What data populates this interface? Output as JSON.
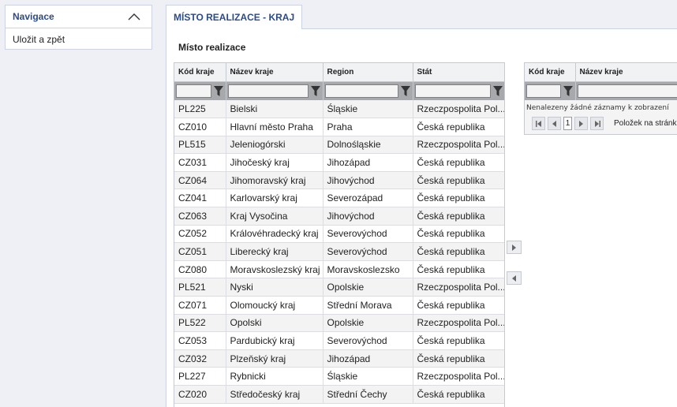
{
  "nav": {
    "title": "Navigace",
    "items": [
      {
        "label": "Uložit a zpět"
      }
    ]
  },
  "tab": {
    "label": "MÍSTO REALIZACE - KRAJ"
  },
  "section": {
    "title": "Místo realizace"
  },
  "left_grid": {
    "columns": [
      "Kód kraje",
      "Název kraje",
      "Region",
      "Stát"
    ],
    "rows": [
      [
        "PL225",
        "Bielski",
        "Śląskie",
        "Rzeczpospolita Pol..."
      ],
      [
        "CZ010",
        "Hlavní město Praha",
        "Praha",
        "Česká republika"
      ],
      [
        "PL515",
        "Jeleniogórski",
        "Dolnośląskie",
        "Rzeczpospolita Pol..."
      ],
      [
        "CZ031",
        "Jihočeský kraj",
        "Jihozápad",
        "Česká republika"
      ],
      [
        "CZ064",
        "Jihomoravský kraj",
        "Jihovýchod",
        "Česká republika"
      ],
      [
        "CZ041",
        "Karlovarský kraj",
        "Severozápad",
        "Česká republika"
      ],
      [
        "CZ063",
        "Kraj Vysočina",
        "Jihovýchod",
        "Česká republika"
      ],
      [
        "CZ052",
        "Královéhradecký kraj",
        "Severovýchod",
        "Česká republika"
      ],
      [
        "CZ051",
        "Liberecký kraj",
        "Severovýchod",
        "Česká republika"
      ],
      [
        "CZ080",
        "Moravskoslezský kraj",
        "Moravskoslezsko",
        "Česká republika"
      ],
      [
        "PL521",
        "Nyski",
        "Opolskie",
        "Rzeczpospolita Pol..."
      ],
      [
        "CZ071",
        "Olomoucký kraj",
        "Střední Morava",
        "Česká republika"
      ],
      [
        "PL522",
        "Opolski",
        "Opolskie",
        "Rzeczpospolita Pol..."
      ],
      [
        "CZ053",
        "Pardubický kraj",
        "Severovýchod",
        "Česká republika"
      ],
      [
        "CZ032",
        "Plzeňský kraj",
        "Jihozápad",
        "Česká republika"
      ],
      [
        "PL227",
        "Rybnicki",
        "Śląskie",
        "Rzeczpospolita Pol..."
      ],
      [
        "CZ020",
        "Středočeský kraj",
        "Střední Čechy",
        "Česká republika"
      ]
    ]
  },
  "right_grid": {
    "columns": [
      "Kód kraje",
      "Název kraje"
    ],
    "empty_message": "Nenalezeny žádné záznamy k zobrazení",
    "pager": {
      "page": "1",
      "page_size_label": "Položek na stránku"
    }
  },
  "icons": {
    "filter": "filter-icon",
    "collapse": "chevron-up-icon",
    "move_right": "arrow-right-icon",
    "move_left": "arrow-left-icon",
    "first": "first-page-icon",
    "prev": "prev-page-icon",
    "next": "next-page-icon",
    "last": "last-page-icon"
  },
  "colors": {
    "accent": "#2c4b86",
    "filter_row": "#a7a9ad"
  }
}
